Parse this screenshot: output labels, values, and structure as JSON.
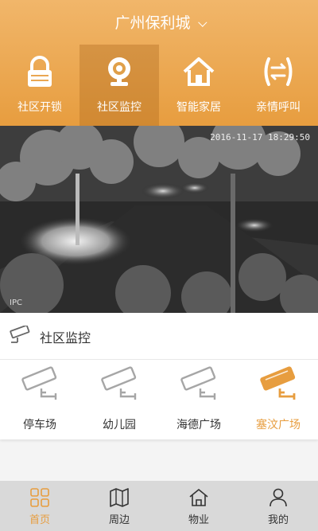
{
  "header": {
    "title": "广州保利城"
  },
  "tabs": [
    {
      "label": "社区开锁",
      "icon": "lock-icon"
    },
    {
      "label": "社区监控",
      "icon": "webcam-icon",
      "active": true
    },
    {
      "label": "智能家居",
      "icon": "home-icon"
    },
    {
      "label": "亲情呼叫",
      "icon": "call-icon"
    }
  ],
  "video": {
    "timestamp": "2016-11-17 18:29:50",
    "label": "IPC"
  },
  "section": {
    "title": "社区监控",
    "icon": "cctv-camera-icon"
  },
  "cameras": [
    {
      "label": "停车场",
      "icon": "cctv-camera-icon"
    },
    {
      "label": "幼儿园",
      "icon": "cctv-camera-icon"
    },
    {
      "label": "海德广场",
      "icon": "cctv-camera-icon"
    },
    {
      "label": "塞汶广场",
      "icon": "cctv-camera-icon",
      "active": true
    }
  ],
  "bottom_nav": [
    {
      "label": "首页",
      "icon": "grid-icon",
      "active": true
    },
    {
      "label": "周边",
      "icon": "map-icon"
    },
    {
      "label": "物业",
      "icon": "home-outline-icon"
    },
    {
      "label": "我的",
      "icon": "user-icon"
    }
  ],
  "colors": {
    "accent": "#e79d3f",
    "header_top": "#f1b66a",
    "inactive_icon": "#a6a6a6"
  }
}
